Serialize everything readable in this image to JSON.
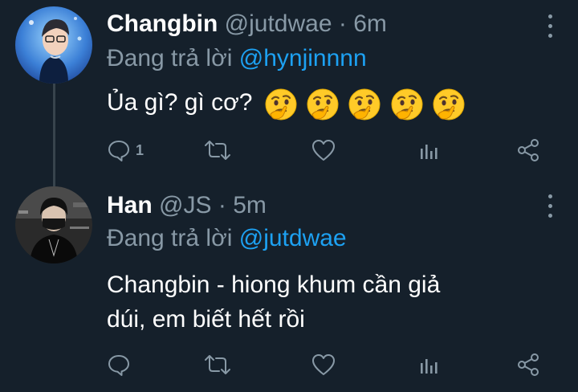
{
  "tweets": [
    {
      "name": "Changbin",
      "handle": "@jutdwae",
      "dot": "·",
      "time": "6m",
      "replying_label": "Đang trả lời",
      "replying_to": "@hynjinnnn",
      "text": "Ủa gì? gì cơ?",
      "emojis": [
        "thinking-face",
        "thinking-face",
        "thinking-face",
        "thinking-face",
        "thinking-face"
      ],
      "reply_count": "1"
    },
    {
      "name": "Han",
      "handle": "@JS",
      "dot": "·",
      "time": "5m",
      "replying_label": "Đang trả lời",
      "replying_to": "@jutdwae",
      "text_line1": "Changbin - hiong khum cần giả",
      "text_line2": "dúi, em biết hết rồi",
      "reply_count": ""
    }
  ],
  "colors": {
    "background": "#15202b",
    "muted": "#8899a6",
    "link": "#1da1f2",
    "divider": "#38444d"
  },
  "icons": [
    "more-vertical-icon",
    "reply-icon",
    "retweet-icon",
    "like-icon",
    "analytics-icon",
    "share-icon"
  ]
}
